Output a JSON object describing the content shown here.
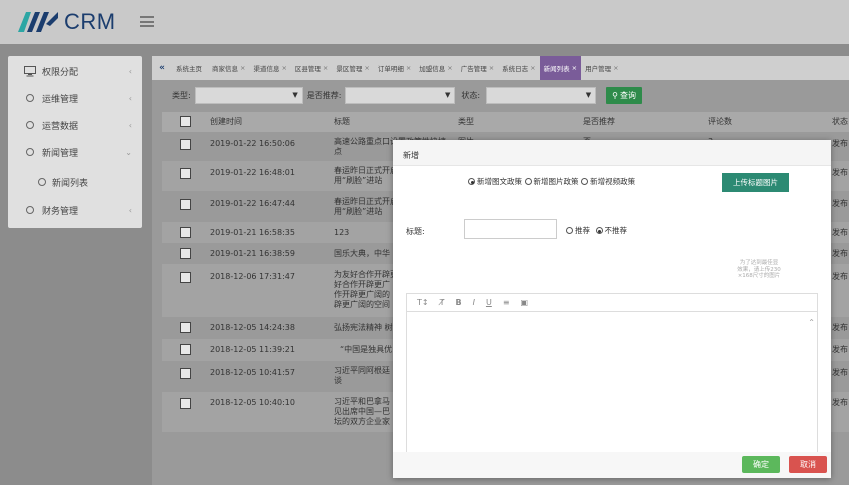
{
  "header": {
    "logo_text": "CRM"
  },
  "sidebar": {
    "items": [
      {
        "label": "权限分配",
        "arrow": "‹"
      },
      {
        "label": "运维管理",
        "arrow": "‹"
      },
      {
        "label": "运营数据",
        "arrow": "‹"
      },
      {
        "label": "新闻管理",
        "arrow": "⌄"
      },
      {
        "label": "新闻列表"
      },
      {
        "label": "财务管理",
        "arrow": "‹"
      }
    ]
  },
  "tabs": [
    {
      "label": "系统主页",
      "close": ""
    },
    {
      "label": "商家信息",
      "close": "×"
    },
    {
      "label": "渠道信息",
      "close": "×"
    },
    {
      "label": "区县管理",
      "close": "×"
    },
    {
      "label": "景区管理",
      "close": "×"
    },
    {
      "label": "订单明细",
      "close": "×"
    },
    {
      "label": "加盟信息",
      "close": "×"
    },
    {
      "label": "广告管理",
      "close": "×"
    },
    {
      "label": "系统日志",
      "close": "×"
    },
    {
      "label": "新闻列表",
      "close": "×"
    },
    {
      "label": "用户管理",
      "close": "×"
    }
  ],
  "filters": {
    "type_label": "类型:",
    "recommend_label": "是否推荐:",
    "status_label": "状态:",
    "search_label": "查询"
  },
  "table": {
    "headers": [
      "创建时间",
      "标题",
      "类型",
      "是否推荐",
      "评论数",
      "状态"
    ],
    "rows": [
      {
        "time": "2019-01-22 16:50:06",
        "title1": "高速公路重点口设置政策性快捷",
        "title2": "点",
        "type": "图片",
        "rec": "否",
        "comments": "3",
        "status": "发布"
      },
      {
        "time": "2019-01-22 16:48:01",
        "title1": "春运昨日正式开启",
        "title2": "用“刷脸”进站",
        "status": "发布"
      },
      {
        "time": "2019-01-22 16:47:44",
        "title1": "春运昨日正式开启",
        "title2": "用“刷脸”进站",
        "status": "发布"
      },
      {
        "time": "2019-01-21 16:58:35",
        "title1": "123",
        "status": "发布"
      },
      {
        "time": "2019-01-21 16:38:59",
        "title1": "国乐大典，中华",
        "status": "发布"
      },
      {
        "time": "2018-12-06 17:31:47",
        "title1": "为友好合作开辟更广",
        "title2": "好合作开辟更广",
        "title3": "作开辟更广阔的",
        "title4": "辟更广阔的空间",
        "status": "发布"
      },
      {
        "time": "2018-12-05 14:24:38",
        "title1": "弘扬宪法精神 树",
        "status": "发布"
      },
      {
        "time": "2018-12-05 11:39:21",
        "title1": "“中国是独具优",
        "status": "发布"
      },
      {
        "time": "2018-12-05 10:41:57",
        "title1": "习近平同阿根廷",
        "title2": "谈",
        "status": "发布"
      },
      {
        "time": "2018-12-05 10:40:10",
        "title1": "习近平和巴拿马",
        "title2": "见出席中国—巴",
        "title3": "坛的双方企业家",
        "status": "发布"
      }
    ]
  },
  "modal": {
    "title": "新增",
    "type_options": [
      "新增图文政策",
      "新增图片政策",
      "新增视频政策"
    ],
    "upload_label": "上传标题图片",
    "title_label": "标题:",
    "recommend_options": [
      "推荐",
      "不推荐"
    ],
    "hint_lines": [
      "为了达到最佳显",
      "效果，请上传230",
      "×168尺寸的图片"
    ],
    "toolbar": [
      "T↕",
      "T̸",
      "B",
      "I",
      "U",
      "≡",
      "▣"
    ],
    "ok_label": "确定",
    "cancel_label": "取消"
  }
}
